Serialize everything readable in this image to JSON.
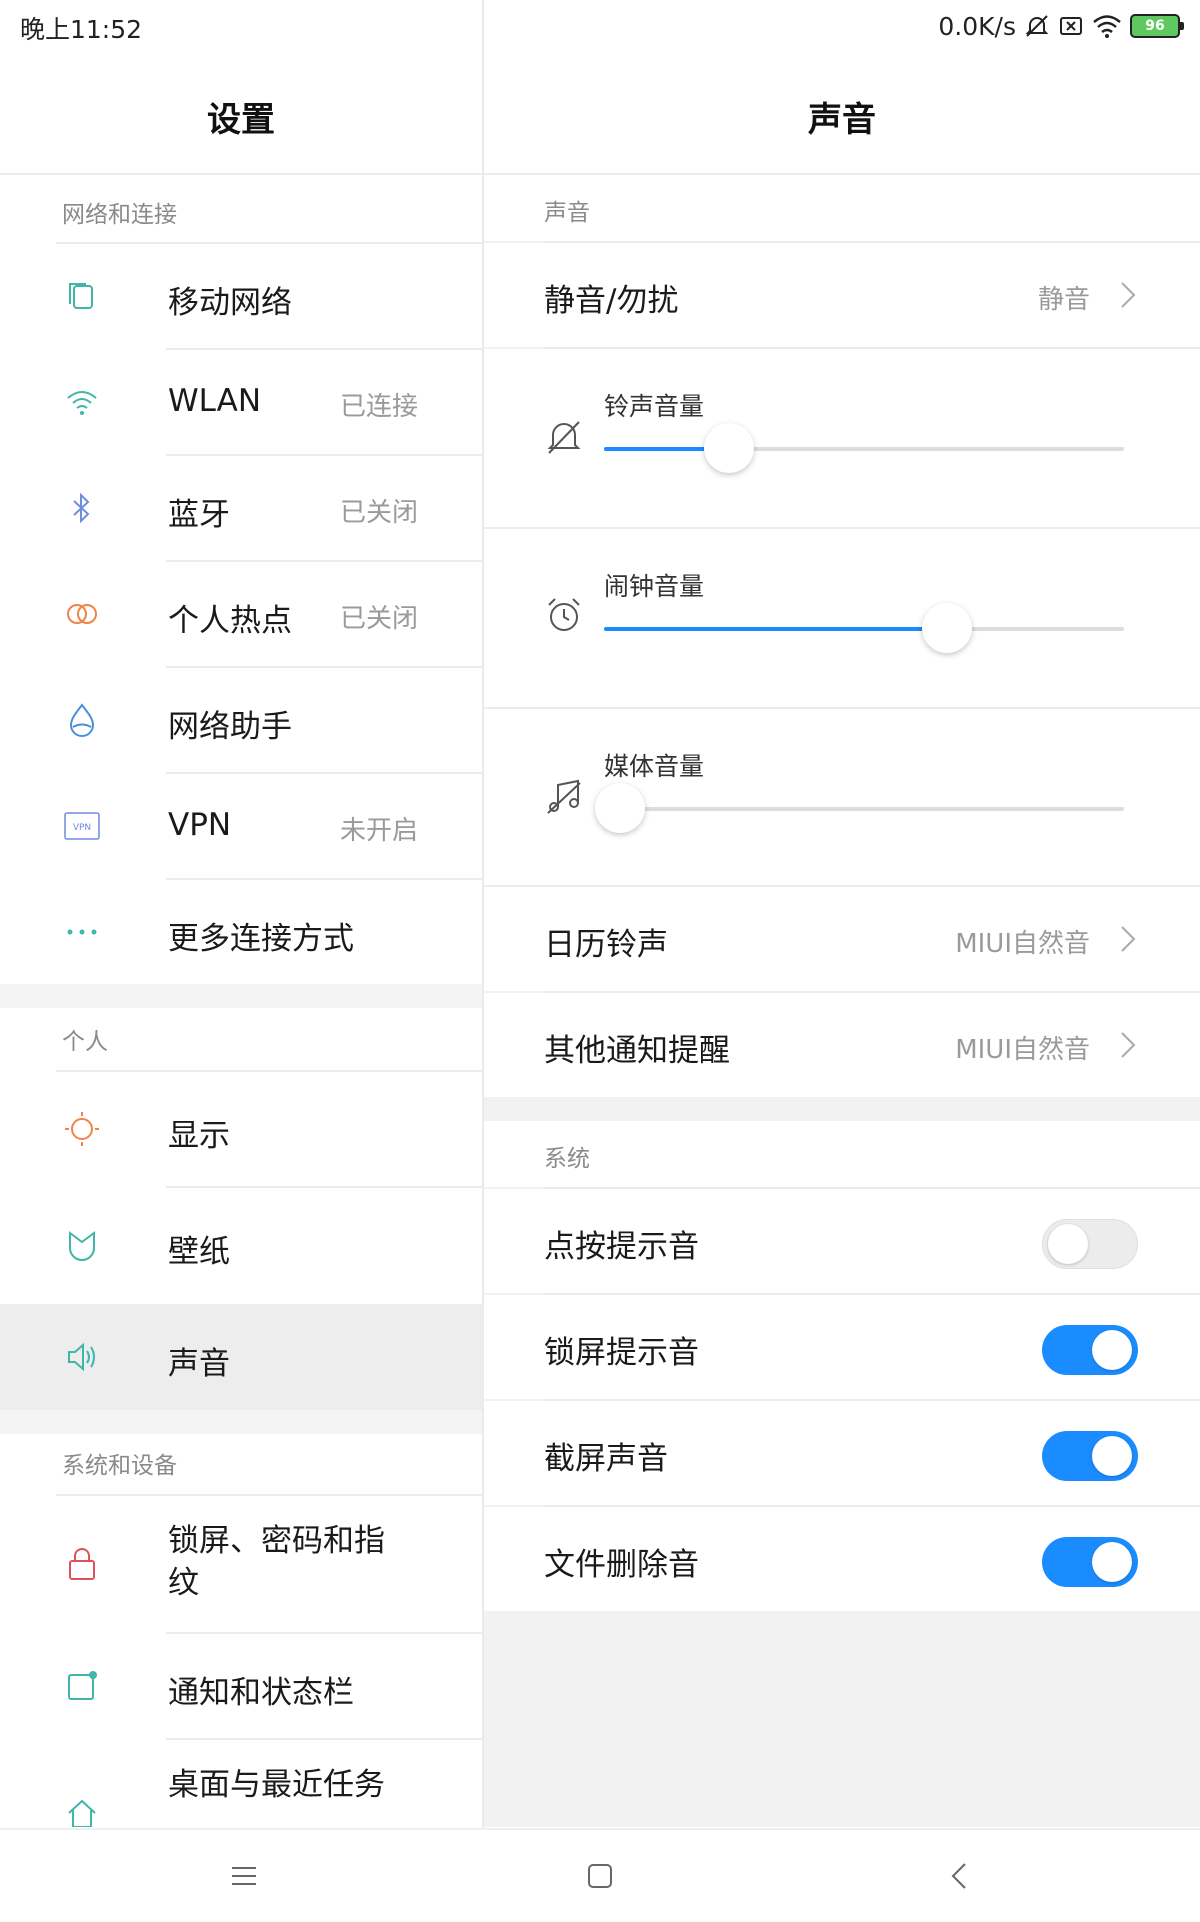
{
  "status_bar": {
    "time": "晚上11:52",
    "net_speed": "0.0K/s",
    "battery": "96",
    "icons": [
      "silent-icon",
      "sim-off-icon",
      "wifi-icon",
      "battery-icon"
    ]
  },
  "left": {
    "title": "设置",
    "sections": {
      "network": "网络和连接",
      "personal": "个人",
      "system_device": "系统和设备"
    },
    "items": {
      "mobile": {
        "label": "移动网络",
        "icon": "mobile-network-icon"
      },
      "wlan": {
        "label": "WLAN",
        "status": "已连接",
        "icon": "wifi-icon"
      },
      "bluetooth": {
        "label": "蓝牙",
        "status": "已关闭",
        "icon": "bluetooth-icon"
      },
      "hotspot": {
        "label": "个人热点",
        "status": "已关闭",
        "icon": "hotspot-icon"
      },
      "assistant": {
        "label": "网络助手",
        "icon": "network-assistant-icon"
      },
      "vpn": {
        "label": "VPN",
        "status": "未开启",
        "icon": "vpn-icon",
        "icon_text": "VPN"
      },
      "more": {
        "label": "更多连接方式",
        "icon": "more-icon"
      },
      "display": {
        "label": "显示",
        "icon": "brightness-icon"
      },
      "wallpaper": {
        "label": "壁纸",
        "icon": "wallpaper-icon"
      },
      "sound": {
        "label": "声音",
        "icon": "speaker-icon"
      },
      "lockscreen": {
        "label": "锁屏、密码和指纹",
        "icon": "lock-icon"
      },
      "notifications": {
        "label": "通知和状态栏",
        "icon": "notification-icon"
      },
      "home": {
        "label": "桌面与最近任务",
        "icon": "home-icon"
      }
    }
  },
  "right": {
    "title": "声音",
    "sections": {
      "sound": "声音",
      "system": "系统"
    },
    "silent_dnd": {
      "label": "静音/勿扰",
      "value": "静音"
    },
    "sliders": {
      "ringtone": {
        "label": "铃声音量",
        "level": 0.24,
        "icon": "bell-muted-icon"
      },
      "alarm": {
        "label": "闹钟音量",
        "level": 0.66,
        "icon": "alarm-clock-icon"
      },
      "media": {
        "label": "媒体音量",
        "level": 0.03,
        "icon": "music-muted-icon"
      }
    },
    "calendar_ringtone": {
      "label": "日历铃声",
      "value": "MIUI自然音"
    },
    "other_notification": {
      "label": "其他通知提醒",
      "value": "MIUI自然音"
    },
    "toggles": {
      "tap_sound": {
        "label": "点按提示音",
        "on": false
      },
      "lock_sound": {
        "label": "锁屏提示音",
        "on": true
      },
      "screenshot_sound": {
        "label": "截屏声音",
        "on": true
      },
      "delete_sound": {
        "label": "文件删除音",
        "on": true
      }
    }
  },
  "nav_bar": {
    "icons": [
      "menu-icon",
      "home-square-icon",
      "back-icon"
    ]
  },
  "colors": {
    "accent": "#1a8cff",
    "teal_icon": "#3fb6a8",
    "orange_icon": "#f0834b",
    "red_icon": "#e0505a"
  }
}
